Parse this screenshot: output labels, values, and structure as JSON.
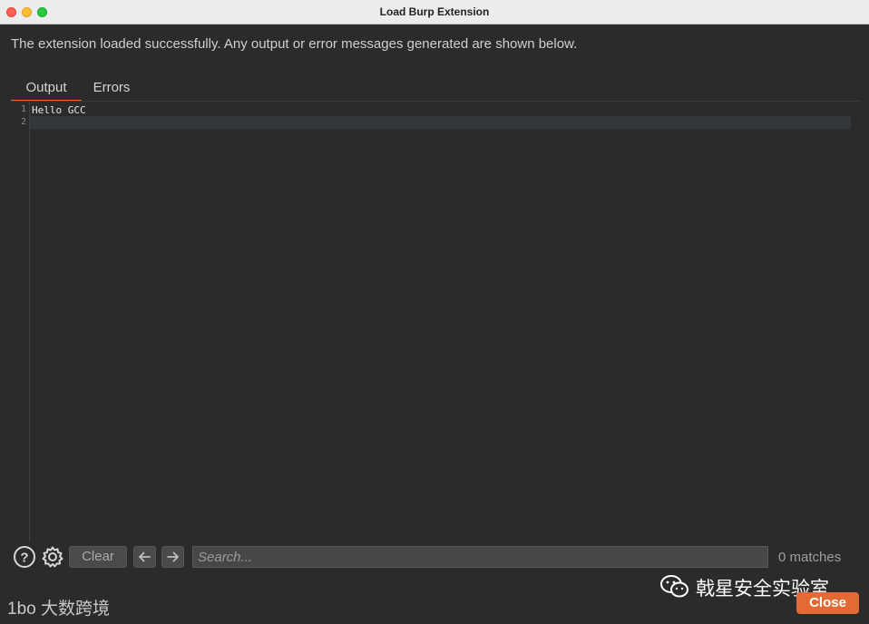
{
  "window": {
    "title": "Load Burp Extension"
  },
  "message": "The extension loaded successfully. Any output or error messages generated are shown below.",
  "tabs": [
    {
      "label": "Output",
      "selected": true
    },
    {
      "label": "Errors",
      "selected": false
    }
  ],
  "editor": {
    "lines": [
      {
        "number": "1",
        "text": "Hello GCC"
      },
      {
        "number": "2",
        "text": ""
      }
    ]
  },
  "toolbar": {
    "help_icon": "help-icon",
    "settings_icon": "gear-icon",
    "clear_label": "Clear",
    "prev_icon": "arrow-left-icon",
    "next_icon": "arrow-right-icon",
    "search_placeholder": "Search...",
    "matches": "0 matches"
  },
  "footer": {
    "close_label": "Close"
  },
  "watermark": {
    "text": "戟星安全实验室"
  },
  "logo": {
    "text": "大数跨境",
    "prefix": "1bo"
  },
  "colors": {
    "accent": "#e36b33",
    "background": "#2b2b2b"
  }
}
